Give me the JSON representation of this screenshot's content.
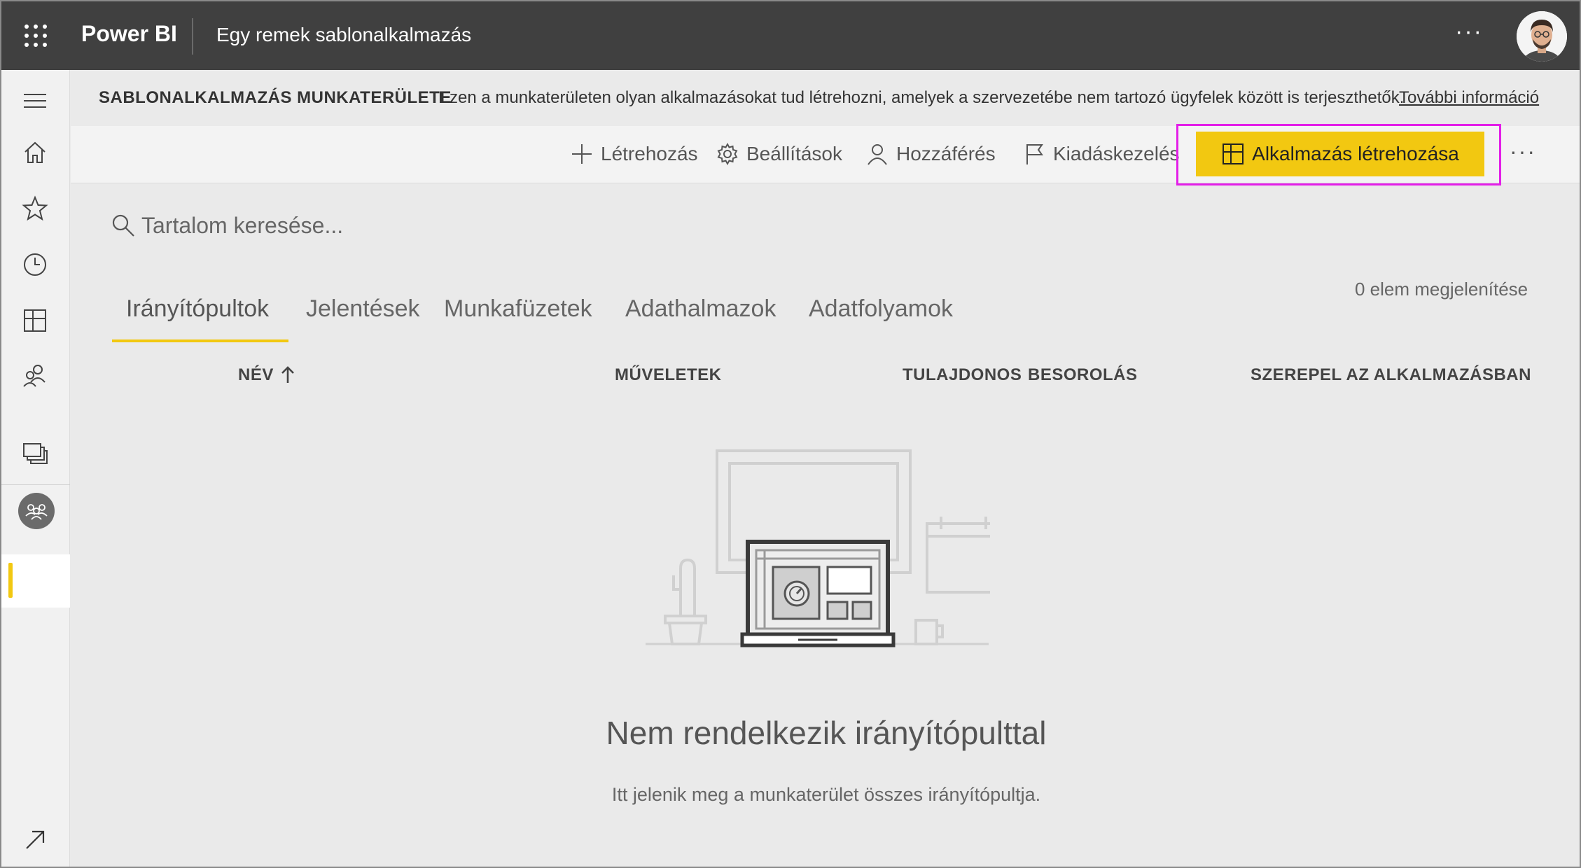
{
  "header": {
    "brand": "Power BI",
    "app_title": "Egy remek sablonalkalmazás",
    "more": "···"
  },
  "banner": {
    "title": "SABLONALKALMAZÁS MUNKATERÜLETE",
    "text": "Ezen a munkaterületen olyan alkalmazásokat tud létrehozni, amelyek a szervezetébe nem tartozó ügyfelek között is terjeszthetők.",
    "link": "További információ"
  },
  "toolbar": {
    "create_label": "Létrehozás",
    "settings_label": "Beállítások",
    "access_label": "Hozzáférés",
    "release_label": "Kiadáskezelés",
    "create_app_label": "Alkalmazás létrehozása",
    "more": "···"
  },
  "search": {
    "placeholder": "Tartalom keresése..."
  },
  "tabs": [
    {
      "label": "Irányítópultok",
      "active": true
    },
    {
      "label": "Jelentések",
      "active": false
    },
    {
      "label": "Munkafüzetek",
      "active": false
    },
    {
      "label": "Adathalmazok",
      "active": false
    },
    {
      "label": "Adatfolyamok",
      "active": false
    }
  ],
  "item_count": "0 elem megjelenítése",
  "columns": {
    "name": "NÉV",
    "actions": "MŰVELETEK",
    "owner": "TULAJDONOS",
    "classification": "BESOROLÁS",
    "in_app": "SZEREPEL AZ ALKALMAZÁSBAN"
  },
  "empty_state": {
    "title": "Nem rendelkezik irányítópulttal",
    "subtitle": "Itt jelenik meg a munkaterület összes irányítópultja."
  },
  "nav_icons": [
    "hamburger-icon",
    "home-icon",
    "star-icon",
    "clock-icon",
    "apps-icon",
    "shared-icon",
    "workspaces-icon",
    "workspace-avatar-icon",
    "expand-icon"
  ],
  "colors": {
    "topbar": "#404040",
    "accent_yellow": "#f2c811",
    "highlight_magenta": "#e31ee8"
  }
}
